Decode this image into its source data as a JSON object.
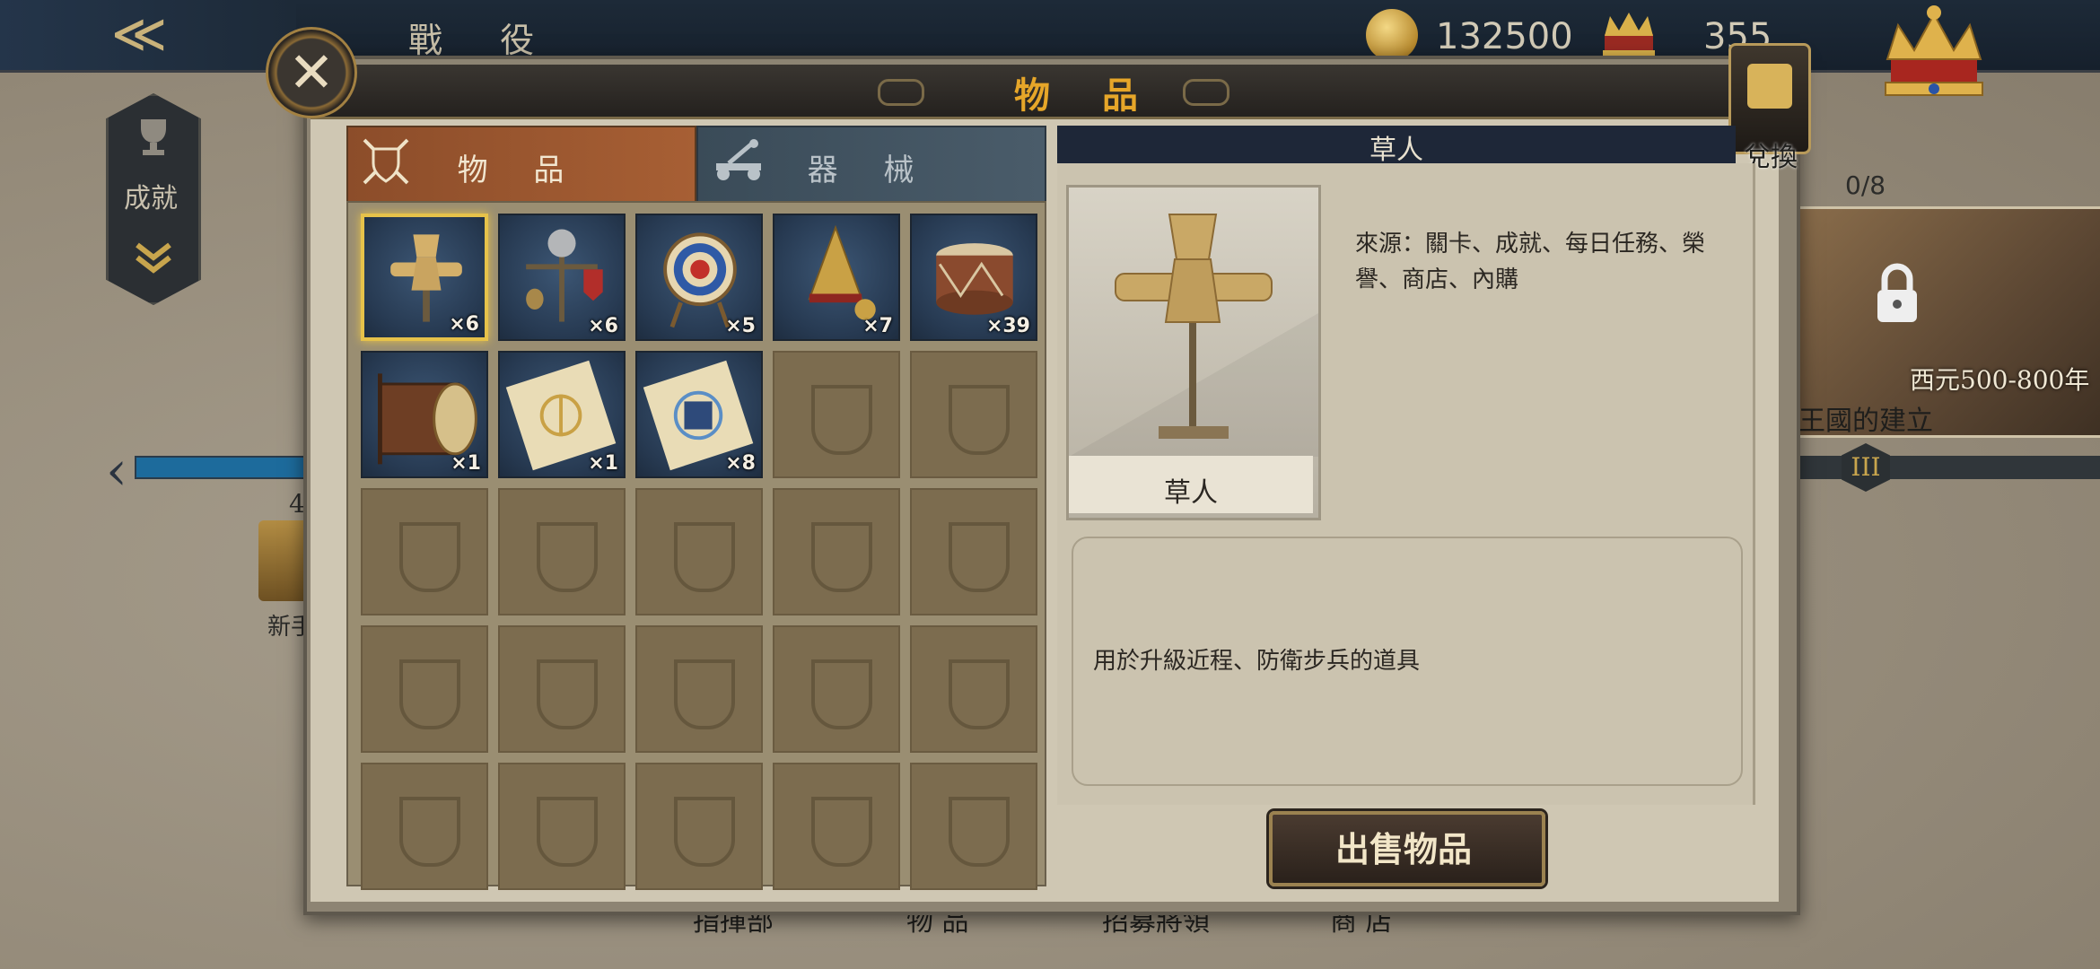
{
  "topbar": {
    "back_icon": "double-chevron-left",
    "title": "戰 役",
    "gold": "132500",
    "gems": "355"
  },
  "left": {
    "achievements_label": "成就",
    "progress_num": "4",
    "book_label": "新手"
  },
  "right": {
    "count": "0/8",
    "era": "西元500-800年",
    "caption": "王國的建立",
    "badge": "III"
  },
  "bottom_nav": [
    "指揮部",
    "物 品",
    "招募將領",
    "商 店"
  ],
  "modal": {
    "title": "物 品",
    "exchange_label": "兌換",
    "tabs": {
      "items": "物 品",
      "machines": "器 械"
    },
    "grid": [
      {
        "name": "straw-dummy",
        "qty": "×6",
        "selected": true
      },
      {
        "name": "armor-stand",
        "qty": "×6"
      },
      {
        "name": "archery-target",
        "qty": "×5"
      },
      {
        "name": "spiked-helmet",
        "qty": "×7"
      },
      {
        "name": "war-drum",
        "qty": "×39"
      },
      {
        "name": "big-drum",
        "qty": "×1"
      },
      {
        "name": "anchor-scroll",
        "qty": "×1"
      },
      {
        "name": "armor-scroll",
        "qty": "×8"
      }
    ],
    "total_slots": 25,
    "detail": {
      "header": "草人",
      "portrait_name": "草人",
      "source": "來源：關卡、成就、每日任務、榮譽、商店、內購",
      "description": "用於升級近程、防衛步兵的道具",
      "sell_button": "出售物品"
    }
  },
  "colors": {
    "accent_gold": "#e6a629",
    "tab_active": "#a75f34",
    "tab_inactive": "#4a5c6a",
    "selected_border": "#e6c24a"
  }
}
